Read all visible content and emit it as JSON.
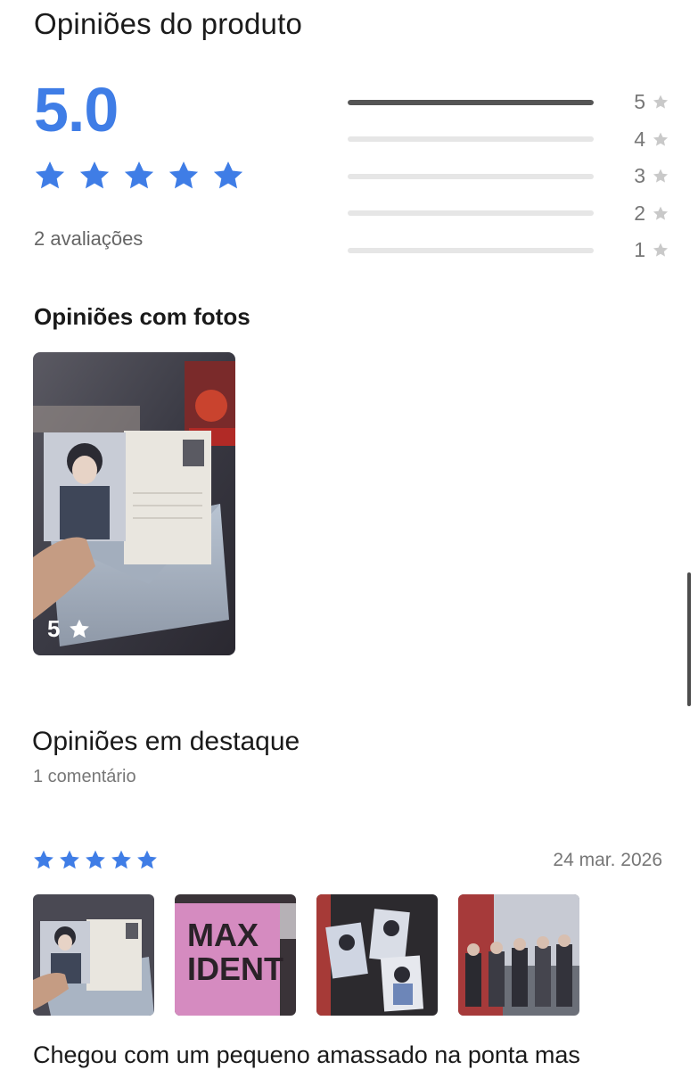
{
  "header": {
    "title": "Opiniões do produto"
  },
  "summary": {
    "average": "5.0",
    "stars": 5,
    "count_label": "2 avaliações",
    "accent_color": "#3f7de6"
  },
  "distribution": [
    {
      "label": "5",
      "fraction": 1.0
    },
    {
      "label": "4",
      "fraction": 0.0
    },
    {
      "label": "3",
      "fraction": 0.0
    },
    {
      "label": "2",
      "fraction": 0.0
    },
    {
      "label": "1",
      "fraction": 0.0
    }
  ],
  "photos_section": {
    "title": "Opiniões com fotos",
    "photo_rating": "5"
  },
  "featured": {
    "title": "Opiniões em destaque",
    "count_label": "1 comentário"
  },
  "review": {
    "stars": 5,
    "date": "24 mar. 2026",
    "photos": [
      "photo-envelope-postcard",
      "photo-pink-album",
      "photo-photocards",
      "photo-group-card"
    ],
    "text": "Chegou com um pequeno amassado na ponta mas"
  },
  "icons": {
    "star": "star-icon"
  }
}
